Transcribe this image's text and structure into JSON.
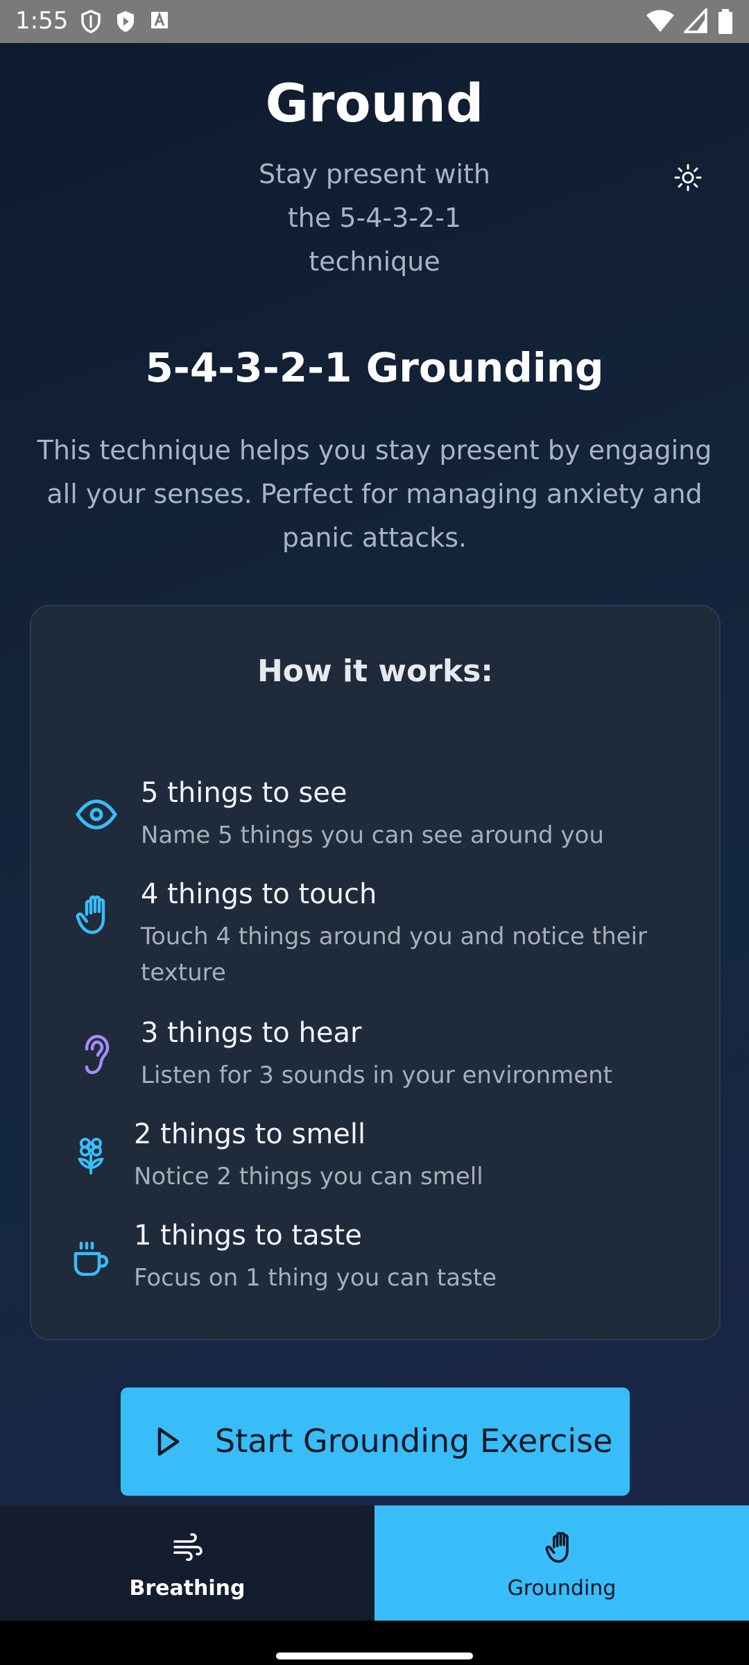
{
  "status_bar": {
    "time": "1:55",
    "left_icons": [
      "shield-outline-icon",
      "shield-play-icon",
      "font-a-icon"
    ],
    "right_icons": [
      "wifi-icon",
      "signal-icon",
      "battery-icon"
    ]
  },
  "header": {
    "title": "Ground",
    "subtitle": "Stay present with the 5-4-3-2-1 technique",
    "theme_icon": "sun-icon"
  },
  "section": {
    "title": "5-4-3-2-1 Grounding",
    "intro": "This technique helps you stay present by engaging all your senses. Perfect for managing anxiety and panic attacks."
  },
  "card": {
    "title": "How it works:",
    "steps": [
      {
        "title": "5 things to see",
        "desc": "Name 5 things you can see around you",
        "icon": "eye-icon",
        "color": "#38bdf8"
      },
      {
        "title": "4 things to touch",
        "desc": "Touch 4 things around you and notice their texture",
        "icon": "hand-icon",
        "color": "#38bdf8"
      },
      {
        "title": "3 things to hear",
        "desc": "Listen for 3 sounds in your environment",
        "icon": "ear-icon",
        "color": "#a78bfa"
      },
      {
        "title": "2 things to smell",
        "desc": "Notice 2 things you can smell",
        "icon": "flower-icon",
        "color": "#38bdf8"
      },
      {
        "title": "1 things to taste",
        "desc": "Focus on 1 thing you can taste",
        "icon": "cup-icon",
        "color": "#38bdf8"
      }
    ]
  },
  "start_button": {
    "label": "Start Grounding Exercise",
    "icon": "play-icon"
  },
  "bottom_nav": {
    "items": [
      {
        "label": "Breathing",
        "icon": "wind-icon",
        "active": false
      },
      {
        "label": "Grounding",
        "icon": "hand-icon",
        "active": true
      }
    ]
  },
  "colors": {
    "accent": "#38bdf8",
    "hear_accent": "#a78bfa",
    "card": "#1f2a3b",
    "background": "#132339"
  }
}
